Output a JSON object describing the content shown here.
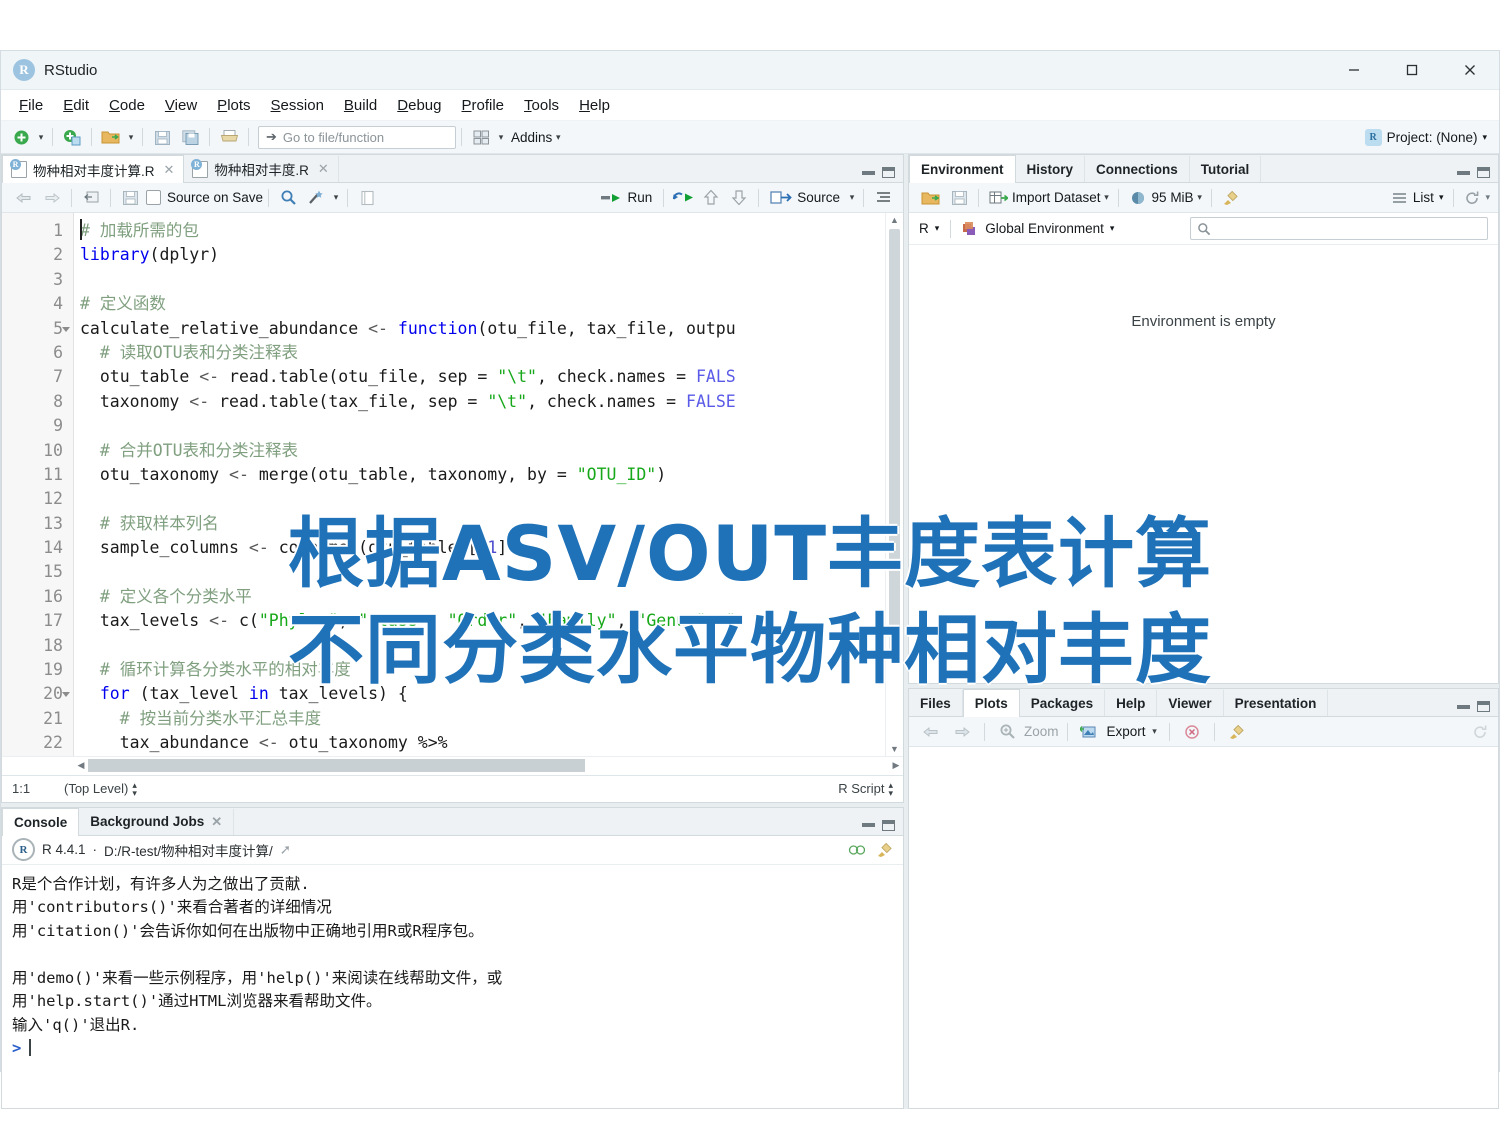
{
  "window": {
    "app_title": "RStudio",
    "logo_letter": "R",
    "controls": {
      "minimize": "minimize-icon",
      "maximize": "maximize-icon",
      "close": "close-icon"
    }
  },
  "menubar": {
    "items": [
      "File",
      "Edit",
      "Code",
      "View",
      "Plots",
      "Session",
      "Build",
      "Debug",
      "Profile",
      "Tools",
      "Help"
    ]
  },
  "main_toolbar": {
    "new_file_icon": "new-file-icon",
    "new_project_icon": "new-project-icon",
    "open_icon": "open-folder-icon",
    "save_icon": "save-icon",
    "save_all_icon": "save-all-icon",
    "print_icon": "print-icon",
    "goto_placeholder": "Go to file/function",
    "workspace_panes_icon": "workspace-panes-icon",
    "addins_label": "Addins",
    "project_label": "Project: (None)"
  },
  "source": {
    "tabs": [
      {
        "label": "物种相对丰度计算.R",
        "active": true
      },
      {
        "label": "物种相对丰度.R",
        "active": false
      }
    ],
    "toolbar": {
      "back_icon": "back-arrow-icon",
      "forward_icon": "forward-arrow-icon",
      "popout_icon": "show-in-new-window-icon",
      "save_icon": "save-icon",
      "source_on_save_label": "Source on Save",
      "find_icon": "search-icon",
      "wand_icon": "code-tools-icon",
      "compile_icon": "compile-report-icon",
      "run_label": "Run",
      "rerun_icon": "rerun-icon",
      "up_icon": "run-previous-icon",
      "down_icon": "run-next-icon",
      "source_label": "Source",
      "outline_icon": "document-outline-icon"
    },
    "code_lines": [
      {
        "n": 1,
        "fold": "",
        "tokens": [
          {
            "t": "# 加载所需的包",
            "c": "cm"
          }
        ]
      },
      {
        "n": 2,
        "fold": "",
        "tokens": [
          {
            "t": "library",
            "c": "kw"
          },
          {
            "t": "(dplyr)",
            "c": ""
          }
        ]
      },
      {
        "n": 3,
        "fold": "",
        "tokens": []
      },
      {
        "n": 4,
        "fold": "",
        "tokens": [
          {
            "t": "# 定义函数",
            "c": "cm"
          }
        ]
      },
      {
        "n": 5,
        "fold": "open",
        "tokens": [
          {
            "t": "calculate_relative_abundance ",
            "c": ""
          },
          {
            "t": "<-",
            "c": "op"
          },
          {
            "t": " ",
            "c": ""
          },
          {
            "t": "function",
            "c": "kw"
          },
          {
            "t": "(otu_file, tax_file, outpu",
            "c": ""
          }
        ]
      },
      {
        "n": 6,
        "fold": "",
        "tokens": [
          {
            "t": "  # 读取OTU表和分类注释表",
            "c": "cm"
          }
        ]
      },
      {
        "n": 7,
        "fold": "",
        "tokens": [
          {
            "t": "  otu_table ",
            "c": ""
          },
          {
            "t": "<-",
            "c": "op"
          },
          {
            "t": " read.table(otu_file, sep = ",
            "c": ""
          },
          {
            "t": "\"\\t\"",
            "c": "str"
          },
          {
            "t": ", check.names = ",
            "c": ""
          },
          {
            "t": "FALS",
            "c": "cnst"
          }
        ]
      },
      {
        "n": 8,
        "fold": "",
        "tokens": [
          {
            "t": "  taxonomy ",
            "c": ""
          },
          {
            "t": "<-",
            "c": "op"
          },
          {
            "t": " read.table(tax_file, sep = ",
            "c": ""
          },
          {
            "t": "\"\\t\"",
            "c": "str"
          },
          {
            "t": ", check.names = ",
            "c": ""
          },
          {
            "t": "FALSE",
            "c": "cnst"
          }
        ]
      },
      {
        "n": 9,
        "fold": "",
        "tokens": []
      },
      {
        "n": 10,
        "fold": "",
        "tokens": [
          {
            "t": "  # 合并OTU表和分类注释表",
            "c": "cm"
          }
        ]
      },
      {
        "n": 11,
        "fold": "",
        "tokens": [
          {
            "t": "  otu_taxonomy ",
            "c": ""
          },
          {
            "t": "<-",
            "c": "op"
          },
          {
            "t": " merge(otu_table, taxonomy, by = ",
            "c": ""
          },
          {
            "t": "\"OTU_ID\"",
            "c": "str"
          },
          {
            "t": ")",
            "c": ""
          }
        ]
      },
      {
        "n": 12,
        "fold": "",
        "tokens": []
      },
      {
        "n": 13,
        "fold": "",
        "tokens": [
          {
            "t": "  # 获取样本列名",
            "c": "cm"
          }
        ]
      },
      {
        "n": 14,
        "fold": "",
        "tokens": [
          {
            "t": "  sample_columns ",
            "c": ""
          },
          {
            "t": "<-",
            "c": "op"
          },
          {
            "t": " colnames(otu_table)[",
            "c": ""
          },
          {
            "t": "-1",
            "c": "num"
          },
          {
            "t": "]",
            "c": ""
          }
        ]
      },
      {
        "n": 15,
        "fold": "",
        "tokens": []
      },
      {
        "n": 16,
        "fold": "",
        "tokens": [
          {
            "t": "  # 定义各个分类水平",
            "c": "cm"
          }
        ]
      },
      {
        "n": 17,
        "fold": "",
        "tokens": [
          {
            "t": "  tax_levels ",
            "c": ""
          },
          {
            "t": "<-",
            "c": "op"
          },
          {
            "t": " c(",
            "c": ""
          },
          {
            "t": "\"Phylum\"",
            "c": "str"
          },
          {
            "t": ", ",
            "c": ""
          },
          {
            "t": "\"Class\"",
            "c": "str"
          },
          {
            "t": ", ",
            "c": ""
          },
          {
            "t": "\"Order\"",
            "c": "str"
          },
          {
            "t": ", ",
            "c": ""
          },
          {
            "t": "\"Family\"",
            "c": "str"
          },
          {
            "t": ", ",
            "c": ""
          },
          {
            "t": "\"Genus\"",
            "c": "str"
          },
          {
            "t": ", ",
            "c": ""
          },
          {
            "t": "\"",
            "c": "str"
          }
        ]
      },
      {
        "n": 18,
        "fold": "",
        "tokens": []
      },
      {
        "n": 19,
        "fold": "",
        "tokens": [
          {
            "t": "  # 循环计算各分类水平的相对丰度",
            "c": "cm"
          }
        ]
      },
      {
        "n": 20,
        "fold": "open",
        "tokens": [
          {
            "t": "  ",
            "c": ""
          },
          {
            "t": "for",
            "c": "kw"
          },
          {
            "t": " (tax_level ",
            "c": ""
          },
          {
            "t": "in",
            "c": "kw"
          },
          {
            "t": " tax_levels) {",
            "c": ""
          }
        ]
      },
      {
        "n": 21,
        "fold": "",
        "tokens": [
          {
            "t": "    # 按当前分类水平汇总丰度",
            "c": "cm"
          }
        ]
      },
      {
        "n": 22,
        "fold": "",
        "tokens": [
          {
            "t": "    tax_abundance ",
            "c": ""
          },
          {
            "t": "<-",
            "c": "op"
          },
          {
            "t": " otu_taxonomy %>%",
            "c": ""
          }
        ]
      }
    ],
    "status": {
      "position": "1:1",
      "scope": "(Top Level)",
      "file_type": "R Script"
    }
  },
  "console": {
    "tabs": [
      {
        "label": "Console",
        "active": true,
        "closable": false
      },
      {
        "label": "Background Jobs",
        "active": false,
        "closable": true
      }
    ],
    "r_version": "R 4.4.1",
    "separator": "·",
    "working_dir": "D:/R-test/物种相对丰度计算/",
    "output_lines": [
      "R是个合作计划，有许多人为之做出了贡献.",
      "用'contributors()'来看合著者的详细情况",
      "用'citation()'会告诉你如何在出版物中正确地引用R或R程序包。",
      "",
      "用'demo()'来看一些示例程序，用'help()'来阅读在线帮助文件，或",
      "用'help.start()'通过HTML浏览器来看帮助文件。",
      "输入'q()'退出R."
    ],
    "prompt": ">"
  },
  "environment": {
    "tabs": [
      {
        "label": "Environment",
        "active": true
      },
      {
        "label": "History",
        "active": false
      },
      {
        "label": "Connections",
        "active": false
      },
      {
        "label": "Tutorial",
        "active": false
      }
    ],
    "toolbar": {
      "load_icon": "load-workspace-icon",
      "save_icon": "save-workspace-icon",
      "import_label": "Import Dataset",
      "memory_label": "95 MiB",
      "broom_icon": "clear-objects-icon",
      "view_mode_label": "List",
      "refresh_icon": "refresh-icon"
    },
    "language_selector": "R",
    "scope_label": "Global Environment",
    "search_placeholder": "",
    "empty_message": "Environment is empty"
  },
  "files_pane": {
    "tabs": [
      {
        "label": "Files",
        "active": false
      },
      {
        "label": "Plots",
        "active": true
      },
      {
        "label": "Packages",
        "active": false
      },
      {
        "label": "Help",
        "active": false
      },
      {
        "label": "Viewer",
        "active": false
      },
      {
        "label": "Presentation",
        "active": false
      }
    ],
    "toolbar": {
      "back_icon": "back-arrow-icon",
      "forward_icon": "forward-arrow-icon",
      "zoom_label": "Zoom",
      "export_label": "Export",
      "remove_icon": "remove-plot-icon",
      "clear_icon": "clear-plots-icon",
      "refresh_icon": "refresh-icon"
    }
  },
  "overlay": {
    "line1": "根据ASV/OUT丰度表计算",
    "line2": "不同分类水平物种相对丰度",
    "color": "#1f72b8"
  }
}
